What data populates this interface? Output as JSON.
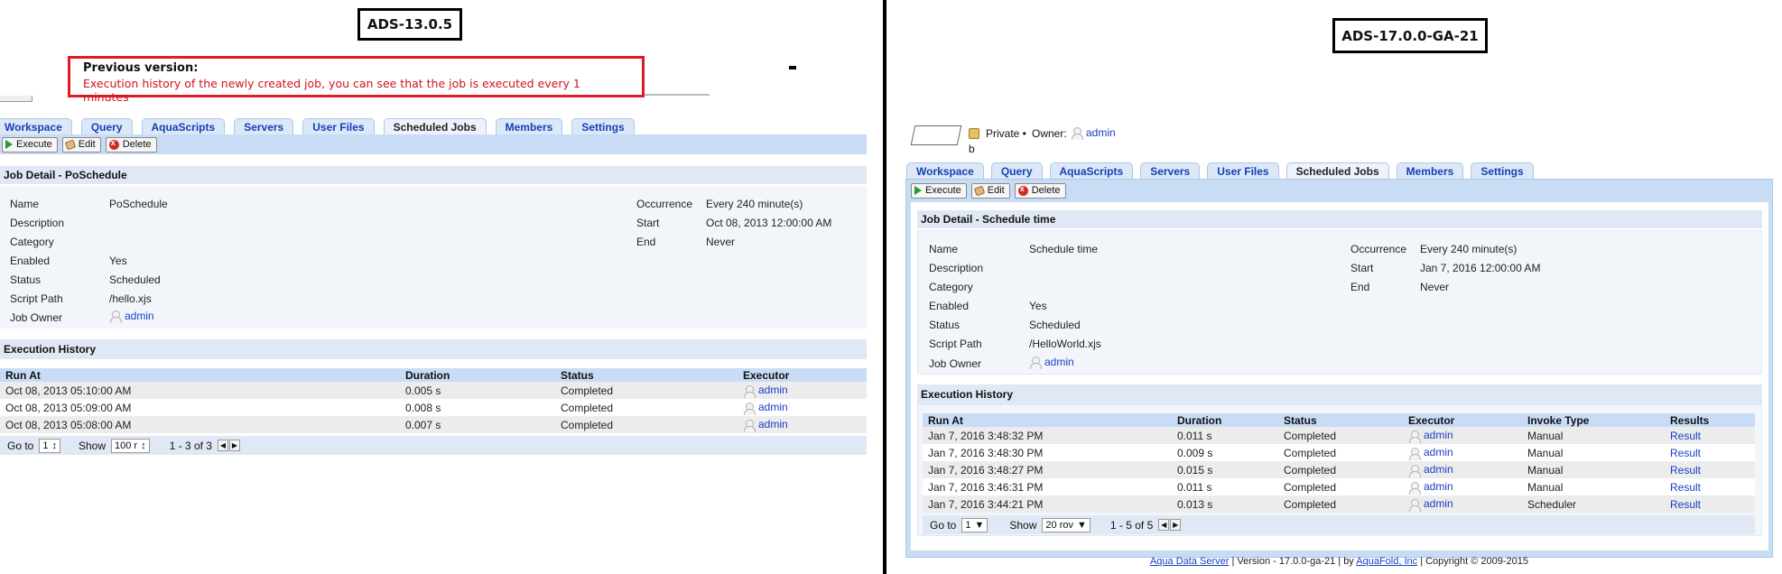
{
  "left": {
    "version_label": "ADS-13.0.5",
    "note": {
      "title": "Previous version:",
      "text": "Execution history of the newly created job, you can see that the job is executed every 1 minutes"
    },
    "tabs": [
      "Workspace",
      "Query",
      "AquaScripts",
      "Servers",
      "User Files",
      "Scheduled Jobs",
      "Members",
      "Settings"
    ],
    "active_tab": "Scheduled Jobs",
    "toolbar": {
      "execute": "Execute",
      "edit": "Edit",
      "delete": "Delete"
    },
    "detail_title": "Job Detail - PoSchedule",
    "detail": {
      "name_label": "Name",
      "name": "PoSchedule",
      "description_label": "Description",
      "category_label": "Category",
      "enabled_label": "Enabled",
      "enabled": "Yes",
      "status_label": "Status",
      "status": "Scheduled",
      "script_label": "Script Path",
      "script": "/hello.xjs",
      "owner_label": "Job Owner",
      "owner": "admin",
      "occurrence_label": "Occurrence",
      "occurrence": "Every 240 minute(s)",
      "start_label": "Start",
      "start": "Oct 08, 2013 12:00:00 AM",
      "end_label": "End",
      "end": "Never"
    },
    "history_title": "Execution History",
    "history_headers": [
      "Run At",
      "Duration",
      "Status",
      "Executor"
    ],
    "history_rows": [
      [
        "Oct 08, 2013 05:10:00 AM",
        "0.005 s",
        "Completed",
        "admin"
      ],
      [
        "Oct 08, 2013 05:09:00 AM",
        "0.008 s",
        "Completed",
        "admin"
      ],
      [
        "Oct 08, 2013 05:08:00 AM",
        "0.007 s",
        "Completed",
        "admin"
      ]
    ],
    "pager": {
      "goto": "Go to",
      "page": "1",
      "show": "Show",
      "rows": "100 r",
      "range": "1 - 3 of 3"
    }
  },
  "right": {
    "version_label": "ADS-17.0.0-GA-21",
    "header": {
      "private": "Private •",
      "owner_label": "Owner:",
      "owner": "admin",
      "sub": "b"
    },
    "tabs": [
      "Workspace",
      "Query",
      "AquaScripts",
      "Servers",
      "User Files",
      "Scheduled Jobs",
      "Members",
      "Settings"
    ],
    "active_tab": "Scheduled Jobs",
    "toolbar": {
      "execute": "Execute",
      "edit": "Edit",
      "delete": "Delete"
    },
    "detail_title": "Job Detail - Schedule time",
    "detail": {
      "name_label": "Name",
      "name": "Schedule time",
      "description_label": "Description",
      "category_label": "Category",
      "enabled_label": "Enabled",
      "enabled": "Yes",
      "status_label": "Status",
      "status": "Scheduled",
      "script_label": "Script Path",
      "script": "/HelloWorld.xjs",
      "owner_label": "Job Owner",
      "owner": "admin",
      "occurrence_label": "Occurrence",
      "occurrence": "Every 240 minute(s)",
      "start_label": "Start",
      "start": "Jan 7, 2016 12:00:00 AM",
      "end_label": "End",
      "end": "Never"
    },
    "history_title": "Execution History",
    "history_headers": [
      "Run At",
      "Duration",
      "Status",
      "Executor",
      "Invoke Type",
      "Results"
    ],
    "history_rows": [
      [
        "Jan 7, 2016 3:48:32 PM",
        "0.011 s",
        "Completed",
        "admin",
        "Manual",
        "Result"
      ],
      [
        "Jan 7, 2016 3:48:30 PM",
        "0.009 s",
        "Completed",
        "admin",
        "Manual",
        "Result"
      ],
      [
        "Jan 7, 2016 3:48:27 PM",
        "0.015 s",
        "Completed",
        "admin",
        "Manual",
        "Result"
      ],
      [
        "Jan 7, 2016 3:46:31 PM",
        "0.011 s",
        "Completed",
        "admin",
        "Manual",
        "Result"
      ],
      [
        "Jan 7, 2016 3:44:21 PM",
        "0.013 s",
        "Completed",
        "admin",
        "Scheduler",
        "Result"
      ]
    ],
    "pager": {
      "goto": "Go to",
      "page": "1",
      "show": "Show",
      "rows": "20 rov",
      "range": "1 - 5 of 5"
    },
    "footer": {
      "app_link": "Aqua Data Server",
      "version": " | Version - 17.0.0-ga-21 | by ",
      "company_link": "AquaFold, Inc",
      "copyright": " | Copyright © 2009-2015"
    }
  },
  "colors": {
    "accent_link": "#1a3fc0",
    "note_border": "#e01b24",
    "toolbar_bg": "#c8dcf5",
    "panel_bg": "#dfe8f4"
  }
}
